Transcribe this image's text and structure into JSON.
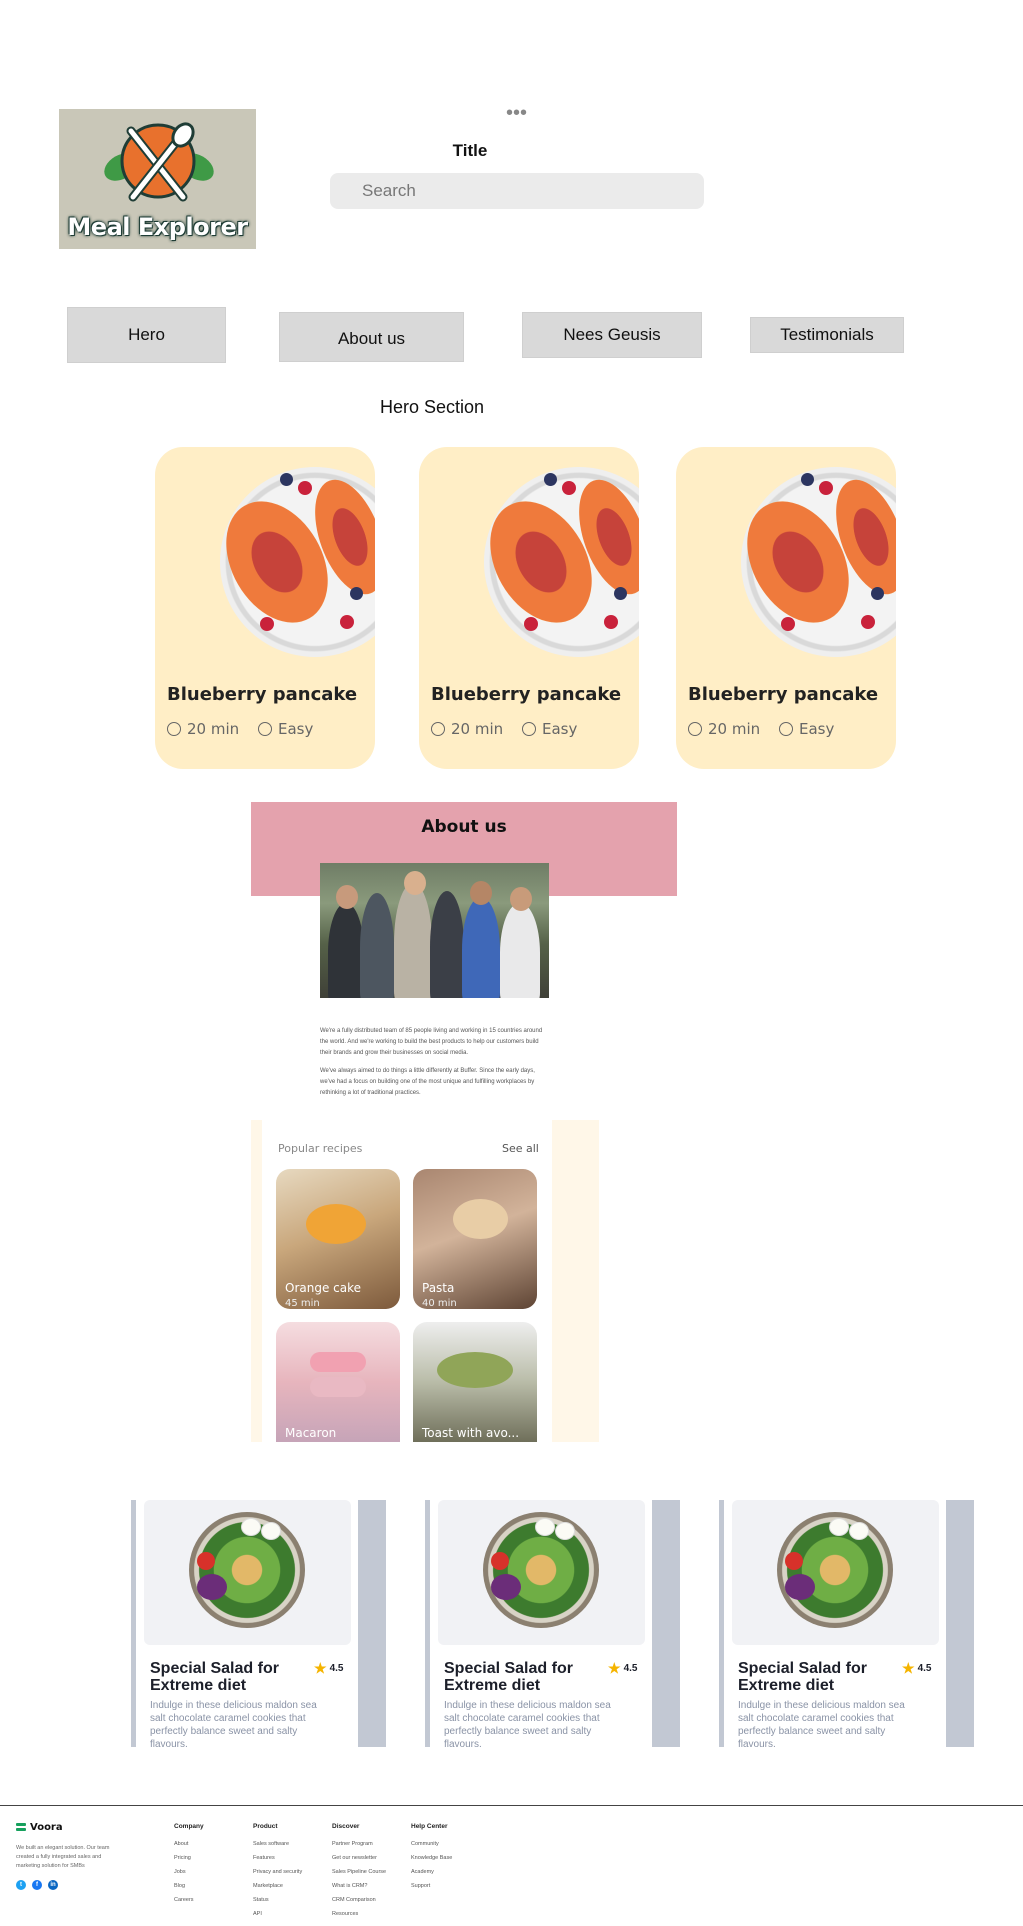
{
  "header": {
    "logo_text": "Meal Explorer",
    "title": "Title",
    "menu_dots": "•••",
    "search_placeholder": "Search"
  },
  "nav": {
    "items": [
      "Hero",
      "About us",
      "Nees Geusis",
      "Testimonials"
    ]
  },
  "hero": {
    "section_label": "Hero Section",
    "cards": [
      {
        "title": "Blueberry pancake",
        "time": "20 min",
        "difficulty": "Easy"
      },
      {
        "title": "Blueberry pancake",
        "time": "20 min",
        "difficulty": "Easy"
      },
      {
        "title": "Blueberry pancake",
        "time": "20 min",
        "difficulty": "Easy"
      }
    ]
  },
  "about": {
    "title": "About us",
    "paragraph1": "We're a fully distributed team of 85 people living and working in 15 countries around the world. And we're working to build the best products to help our customers build their brands and grow their businesses on social media.",
    "paragraph2": "We've always aimed to do things a little differently at Buffer. Since the early days, we've had a focus on building one of the most unique and fulfilling workplaces by rethinking a lot of traditional practices."
  },
  "popular": {
    "heading": "Popular recipes",
    "see_all": "See all",
    "items": [
      {
        "name": "Orange cake",
        "time": "45 min"
      },
      {
        "name": "Pasta",
        "time": "40 min"
      },
      {
        "name": "Macaron",
        "time": ""
      },
      {
        "name": "Toast with avo...",
        "time": ""
      }
    ]
  },
  "salads": [
    {
      "title": "Special Salad for Extreme diet",
      "rating": "4.5",
      "description": "Indulge in these delicious maldon sea salt chocolate caramel cookies that perfectly balance sweet and salty flavours."
    },
    {
      "title": "Special Salad for Extreme diet",
      "rating": "4.5",
      "description": "Indulge in these delicious maldon sea salt chocolate caramel cookies that perfectly balance sweet and salty flavours."
    },
    {
      "title": "Special Salad for Extreme diet",
      "rating": "4.5",
      "description": "Indulge in these delicious maldon sea salt chocolate caramel cookies that perfectly balance sweet and salty flavours."
    }
  ],
  "footer": {
    "brand": "Voora",
    "description": "We built an elegant solution. Our team created a fully integrated sales and marketing solution for SMBs",
    "social_icons": [
      "twitter-icon",
      "facebook-icon",
      "linkedin-icon"
    ],
    "social_glyphs": [
      "t",
      "f",
      "in"
    ],
    "colors": {
      "twitter": "#1da1f2",
      "facebook": "#1877f2",
      "linkedin": "#0a66c2"
    },
    "columns": [
      {
        "title": "Company",
        "links": [
          "About",
          "Pricing",
          "Jobs",
          "Blog",
          "Careers"
        ]
      },
      {
        "title": "Product",
        "links": [
          "Sales software",
          "Features",
          "Privacy and security",
          "Marketplace",
          "Status",
          "API"
        ]
      },
      {
        "title": "Discover",
        "links": [
          "Partner Program",
          "Get our newsletter",
          "Sales Pipeline Course",
          "What is CRM?",
          "CRM Comparison",
          "Resources"
        ]
      },
      {
        "title": "Help Center",
        "links": [
          "Community",
          "Knowledge Base",
          "Academy",
          "Support"
        ]
      }
    ]
  }
}
